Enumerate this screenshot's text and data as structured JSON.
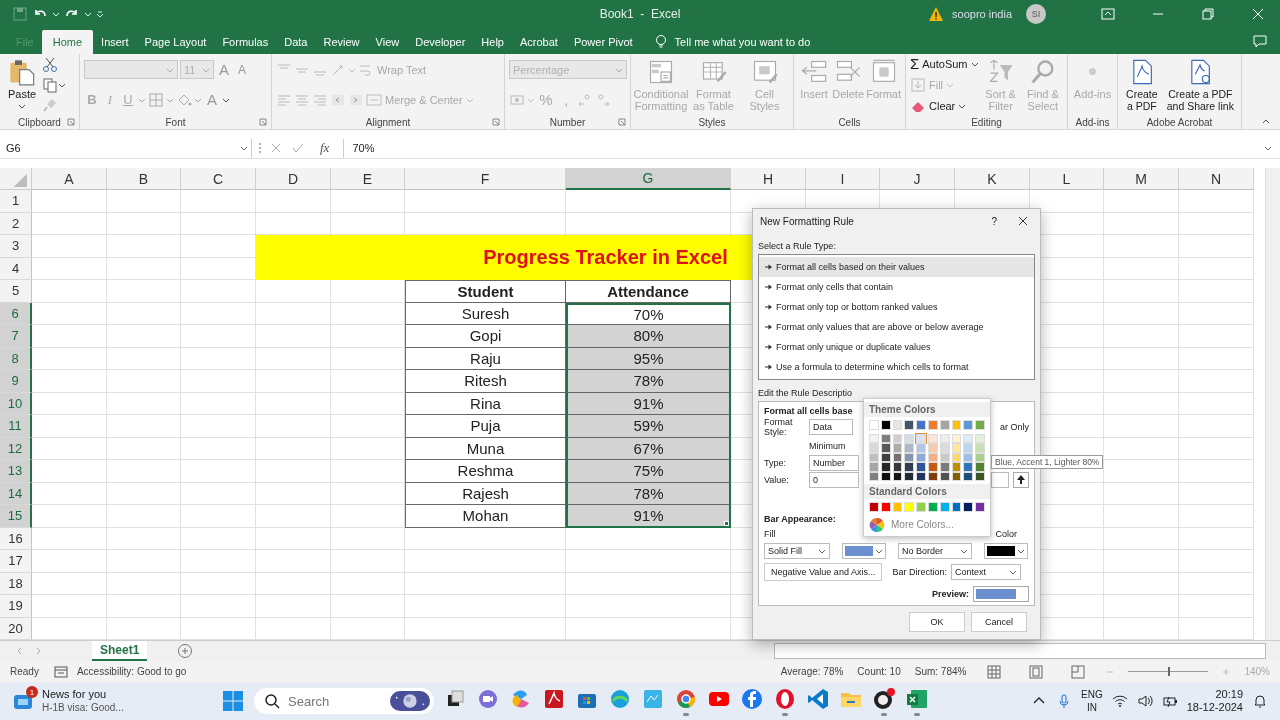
{
  "title_bar": {
    "title": "Book1  -  Excel",
    "user": "soopro india",
    "avatar": "SI"
  },
  "tabs": [
    {
      "label": "File",
      "selected": false,
      "disabled": true
    },
    {
      "label": "Home",
      "selected": true,
      "disabled": false
    },
    {
      "label": "Insert",
      "selected": false,
      "disabled": false
    },
    {
      "label": "Page Layout",
      "selected": false,
      "disabled": false
    },
    {
      "label": "Formulas",
      "selected": false,
      "disabled": false
    },
    {
      "label": "Data",
      "selected": false,
      "disabled": false
    },
    {
      "label": "Review",
      "selected": false,
      "disabled": false
    },
    {
      "label": "View",
      "selected": false,
      "disabled": false
    },
    {
      "label": "Developer",
      "selected": false,
      "disabled": false
    },
    {
      "label": "Help",
      "selected": false,
      "disabled": false
    },
    {
      "label": "Acrobat",
      "selected": false,
      "disabled": false
    },
    {
      "label": "Power Pivot",
      "selected": false,
      "disabled": false
    }
  ],
  "tell_me": "Tell me what you want to do",
  "ribbon": {
    "groups": [
      {
        "kind": "clipboard",
        "label": "Clipboard",
        "buttons": [
          {
            "label": "Paste",
            "disabled": false
          }
        ]
      },
      {
        "kind": "font",
        "label": "Font",
        "font_size": "11",
        "glyphs": [
          "A",
          "A",
          "B",
          "I",
          "U",
          "A"
        ]
      },
      {
        "kind": "alignment",
        "label": "Alignment",
        "buttons": [
          {
            "label": "Wrap Text",
            "disabled": true
          },
          {
            "label": "Merge & Center",
            "disabled": true
          }
        ]
      },
      {
        "kind": "number",
        "label": "Number",
        "format": "Percentage",
        "glyphs": [
          "%",
          ","
        ]
      },
      {
        "kind": "styles",
        "label": "Styles",
        "buttons": [
          {
            "label": "Conditional Formatting",
            "disabled": true
          },
          {
            "label": "Format as Table",
            "disabled": true
          },
          {
            "label": "Cell Styles",
            "disabled": true
          }
        ]
      },
      {
        "kind": "cells",
        "label": "Cells",
        "buttons": [
          {
            "label": "Insert",
            "disabled": true
          },
          {
            "label": "Delete",
            "disabled": true
          },
          {
            "label": "Format",
            "disabled": true
          }
        ]
      },
      {
        "kind": "editing",
        "label": "Editing",
        "buttons": [
          {
            "label": "AutoSum",
            "glyph": "Σ",
            "disabled": false
          },
          {
            "label": "Fill",
            "disabled": true
          },
          {
            "label": "Clear",
            "disabled": false
          },
          {
            "label": "Sort & Filter",
            "disabled": true
          },
          {
            "label": "Find & Select",
            "disabled": true
          }
        ]
      },
      {
        "kind": "addins",
        "label": "Add-ins",
        "buttons": [
          {
            "label": "Add-ins",
            "disabled": true
          }
        ]
      },
      {
        "kind": "acrobat",
        "label": "Adobe Acrobat",
        "buttons": [
          {
            "label": "Create a PDF",
            "disabled": false
          },
          {
            "label": "Create a PDF and Share link",
            "disabled": false
          }
        ]
      }
    ]
  },
  "formula_bar": {
    "name_box": "G6",
    "fx": "fx",
    "value": "70%"
  },
  "sheet": {
    "columns": [
      {
        "label": "A",
        "selected": false
      },
      {
        "label": "B",
        "selected": false
      },
      {
        "label": "C",
        "selected": false
      },
      {
        "label": "D",
        "selected": false
      },
      {
        "label": "E",
        "selected": false
      },
      {
        "label": "F",
        "selected": false
      },
      {
        "label": "G",
        "selected": true
      },
      {
        "label": "H",
        "selected": false
      },
      {
        "label": "I",
        "selected": false
      },
      {
        "label": "J",
        "selected": false
      },
      {
        "label": "K",
        "selected": false
      },
      {
        "label": "L",
        "selected": false
      },
      {
        "label": "M",
        "selected": false
      },
      {
        "label": "N",
        "selected": false
      }
    ],
    "rows": [
      {
        "label": "1",
        "selected": false
      },
      {
        "label": "2",
        "selected": false
      },
      {
        "label": "3",
        "selected": false
      },
      {
        "label": "4",
        "selected": false
      },
      {
        "label": "5",
        "selected": false
      },
      {
        "label": "6",
        "selected": true
      },
      {
        "label": "7",
        "selected": true
      },
      {
        "label": "8",
        "selected": true
      },
      {
        "label": "9",
        "selected": true
      },
      {
        "label": "10",
        "selected": true
      },
      {
        "label": "11",
        "selected": true
      },
      {
        "label": "12",
        "selected": true
      },
      {
        "label": "13",
        "selected": true
      },
      {
        "label": "14",
        "selected": true
      },
      {
        "label": "15",
        "selected": true
      },
      {
        "label": "16",
        "selected": false
      },
      {
        "label": "17",
        "selected": false
      },
      {
        "label": "18",
        "selected": false
      },
      {
        "label": "19",
        "selected": false
      },
      {
        "label": "20",
        "selected": false
      }
    ],
    "title": "Progress Tracker in Excel",
    "table": {
      "columns": [
        "Student",
        "Attendance"
      ],
      "rows": [
        {
          "student": "Suresh",
          "attendance": "70%",
          "active": true
        },
        {
          "student": "Gopi",
          "attendance": "80%",
          "active": false
        },
        {
          "student": "Raju",
          "attendance": "95%",
          "active": false
        },
        {
          "student": "Ritesh",
          "attendance": "78%",
          "active": false
        },
        {
          "student": "Rina",
          "attendance": "91%",
          "active": false
        },
        {
          "student": "Puja",
          "attendance": "59%",
          "active": false
        },
        {
          "student": "Muna",
          "attendance": "67%",
          "active": false
        },
        {
          "student": "Reshma",
          "attendance": "75%",
          "active": false
        },
        {
          "student": "Rajesh",
          "attendance": "78%",
          "active": false
        },
        {
          "student": "Mohan",
          "attendance": "91%",
          "active": false
        }
      ]
    }
  },
  "sheet_tabs": [
    {
      "label": "Sheet1",
      "selected": true
    }
  ],
  "status_bar": {
    "mode": "Ready",
    "accessibility": "Accessibility: Good to go",
    "average": "Average: 78%",
    "count": "Count: 10",
    "sum": "Sum: 784%",
    "zoom": {
      "label": "140%",
      "level": 0.5
    }
  },
  "dialog": {
    "title": "New Formatting Rule",
    "help": "?",
    "select_label": "Select a Rule Type:",
    "rule_types": [
      {
        "label": "Format all cells based on their values",
        "selected": true
      },
      {
        "label": "Format only cells that contain",
        "selected": false
      },
      {
        "label": "Format only top or bottom ranked values",
        "selected": false
      },
      {
        "label": "Format only values that are above or below average",
        "selected": false
      },
      {
        "label": "Format only unique or duplicate values",
        "selected": false
      },
      {
        "label": "Use a formula to determine which cells to format",
        "selected": false
      }
    ],
    "edit_label": "Edit the Rule Descriptio",
    "heading": "Format all cells base",
    "format_style_label": "Format Style:",
    "format_style": "Data",
    "bar_only": "ar Only",
    "minimum": "Minimum",
    "type_label": "Type:",
    "min_type": "Number",
    "value_label": "Value:",
    "min_value": "0",
    "bar_appearance": "Bar Appearance:",
    "fill_label": "Fill",
    "fill": "Solid Fill",
    "border": "No Border",
    "color_label": "Color",
    "negative_button": "Negative Value and Axis...",
    "direction_label": "Bar Direction:",
    "direction": "Context",
    "preview_label": "Preview:",
    "ok": "OK",
    "cancel": "Cancel",
    "palette": {
      "theme_label": "Theme Colors",
      "theme_rows": [
        {
          "swatches": [
            {
              "color": "#ffffff",
              "selected": false
            },
            {
              "color": "#000000",
              "selected": false
            },
            {
              "color": "#e7e6e6",
              "selected": false
            },
            {
              "color": "#44546a",
              "selected": false
            },
            {
              "color": "#4472c4",
              "selected": false
            },
            {
              "color": "#ed7d31",
              "selected": false
            },
            {
              "color": "#a5a5a5",
              "selected": false
            },
            {
              "color": "#ffc000",
              "selected": false
            },
            {
              "color": "#5b9bd5",
              "selected": false
            },
            {
              "color": "#70ad47",
              "selected": false
            }
          ]
        },
        {
          "swatches": [
            {
              "color": "#f2f2f2",
              "selected": false
            },
            {
              "color": "#7f7f7f",
              "selected": false
            },
            {
              "color": "#d0cece",
              "selected": false
            },
            {
              "color": "#d6dce4",
              "selected": false
            },
            {
              "color": "#d9e1f2",
              "selected": true
            },
            {
              "color": "#fce4d6",
              "selected": false
            },
            {
              "color": "#ededed",
              "selected": false
            },
            {
              "color": "#fff2cc",
              "selected": false
            },
            {
              "color": "#ddebf7",
              "selected": false
            },
            {
              "color": "#e2efda",
              "selected": false
            }
          ]
        },
        {
          "swatches": [
            {
              "color": "#d9d9d9",
              "selected": false
            },
            {
              "color": "#595959",
              "selected": false
            },
            {
              "color": "#aeabab",
              "selected": false
            },
            {
              "color": "#adb9ca",
              "selected": false
            },
            {
              "color": "#b4c6e7",
              "selected": false
            },
            {
              "color": "#f8cbad",
              "selected": false
            },
            {
              "color": "#dbdbdb",
              "selected": false
            },
            {
              "color": "#ffe699",
              "selected": false
            },
            {
              "color": "#bdd7ee",
              "selected": false
            },
            {
              "color": "#c6e0b4",
              "selected": false
            }
          ]
        },
        {
          "swatches": [
            {
              "color": "#bfbfbf",
              "selected": false
            },
            {
              "color": "#404040",
              "selected": false
            },
            {
              "color": "#757171",
              "selected": false
            },
            {
              "color": "#8497b0",
              "selected": false
            },
            {
              "color": "#8ea9db",
              "selected": false
            },
            {
              "color": "#f4b084",
              "selected": false
            },
            {
              "color": "#c9c9c9",
              "selected": false
            },
            {
              "color": "#ffd966",
              "selected": false
            },
            {
              "color": "#9bc2e6",
              "selected": false
            },
            {
              "color": "#a9d08e",
              "selected": false
            }
          ]
        },
        {
          "swatches": [
            {
              "color": "#a6a6a6",
              "selected": false
            },
            {
              "color": "#262626",
              "selected": false
            },
            {
              "color": "#3a3838",
              "selected": false
            },
            {
              "color": "#333f4f",
              "selected": false
            },
            {
              "color": "#2f5496",
              "selected": false
            },
            {
              "color": "#c65911",
              "selected": false
            },
            {
              "color": "#7b7b7b",
              "selected": false
            },
            {
              "color": "#bf8f00",
              "selected": false
            },
            {
              "color": "#2f75b5",
              "selected": false
            },
            {
              "color": "#548235",
              "selected": false
            }
          ]
        },
        {
          "swatches": [
            {
              "color": "#808080",
              "selected": false
            },
            {
              "color": "#0d0d0d",
              "selected": false
            },
            {
              "color": "#171616",
              "selected": false
            },
            {
              "color": "#222a35",
              "selected": false
            },
            {
              "color": "#203764",
              "selected": false
            },
            {
              "color": "#833c0b",
              "selected": false
            },
            {
              "color": "#525252",
              "selected": false
            },
            {
              "color": "#806000",
              "selected": false
            },
            {
              "color": "#1f4e78",
              "selected": false
            },
            {
              "color": "#375623",
              "selected": false
            }
          ]
        }
      ],
      "standard_label": "Standard Colors",
      "standard": [
        {
          "color": "#c00000"
        },
        {
          "color": "#ff0000"
        },
        {
          "color": "#ffc000"
        },
        {
          "color": "#ffff00"
        },
        {
          "color": "#92d050"
        },
        {
          "color": "#00b050"
        },
        {
          "color": "#00b0f0"
        },
        {
          "color": "#0070c0"
        },
        {
          "color": "#002060"
        },
        {
          "color": "#7030a0"
        }
      ],
      "more": "More Colors...",
      "tooltip": "Blue, Accent 1, Lighter 80%"
    }
  },
  "taskbar": {
    "news": {
      "badge": "1",
      "title": "News for you",
      "subtitle": "H-1B visa: Good..."
    },
    "search": {
      "placeholder": "Search"
    },
    "apps": [
      {
        "running": false
      },
      {
        "running": false
      },
      {
        "running": false
      },
      {
        "running": false
      },
      {
        "running": false
      },
      {
        "running": false
      },
      {
        "running": false
      },
      {
        "running": true
      },
      {
        "running": false
      },
      {
        "running": false
      },
      {
        "running": true
      },
      {
        "running": false
      },
      {
        "running": false
      },
      {
        "running": true
      },
      {
        "running": true
      }
    ],
    "language": "ENG",
    "region": "IN",
    "time": "20:19",
    "date": "18-12-2024"
  }
}
